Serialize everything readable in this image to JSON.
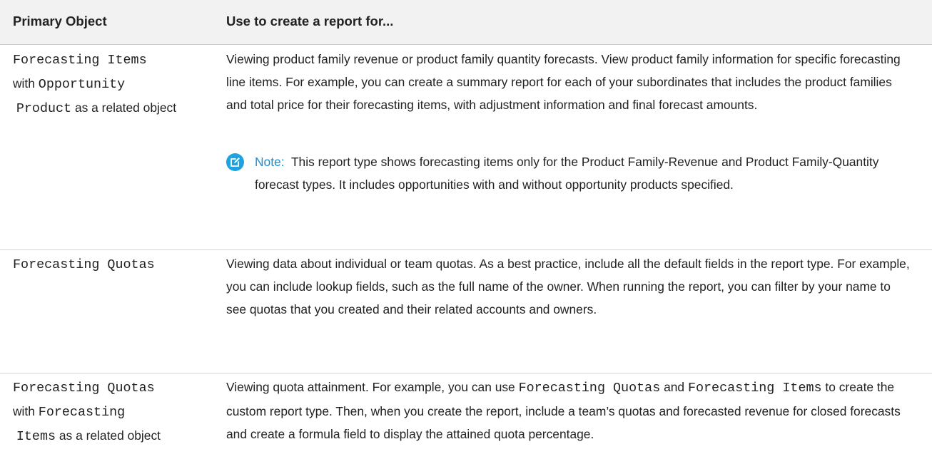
{
  "table": {
    "headers": [
      "Primary Object",
      "Use to create a report for..."
    ],
    "rows": [
      {
        "object_parts": [
          {
            "text": "Forecasting Items",
            "mono": true
          },
          {
            "text": "with",
            "mono": false
          },
          {
            "text": "Opportunity",
            "mono": true
          },
          {
            "text": "Product",
            "mono": true
          },
          {
            "text": "as a related object",
            "mono": false
          }
        ],
        "description": "Viewing product family revenue or product family quantity forecasts. View product family information for specific forecasting line items. For example, you can create a summary report for each of your subordinates that includes the product families and total price for their forecasting items, with adjustment information and final forecast amounts.",
        "note_label": "Note:",
        "note_text": "This report type shows forecasting items only for the Product Family-Revenue and Product Family-Quantity forecast types. It includes opportunities with and without opportunity products specified."
      },
      {
        "object_parts": [
          {
            "text": "Forecasting Quotas",
            "mono": true
          }
        ],
        "description": "Viewing data about individual or team quotas. As a best practice, include all the default fields in the report type. For example, you can include lookup fields, such as the full name of the owner. When running the report, you can filter by your name to see quotas that you created and their related accounts and owners."
      },
      {
        "object_parts": [
          {
            "text": "Forecasting Quotas",
            "mono": true
          },
          {
            "text": "with",
            "mono": false
          },
          {
            "text": "Forecasting",
            "mono": true
          },
          {
            "text": "Items",
            "mono": true
          },
          {
            "text": "as a related object",
            "mono": false
          }
        ],
        "description_parts": [
          {
            "text": "Viewing quota attainment. For example, you can use",
            "mono": false
          },
          {
            "text": "Forecasting Quotas",
            "mono": true
          },
          {
            "text": "and",
            "mono": false
          },
          {
            "text": "Forecasting Items",
            "mono": true
          },
          {
            "text": "to create the custom report type. Then, when you create the report, include a team’s quotas and forecasted revenue for closed forecasts and create a formula field to display the attained quota percentage.",
            "mono": false
          }
        ]
      }
    ]
  },
  "icons": {
    "note": "edit-note-icon"
  },
  "colors": {
    "note_accent": "#1a8ccf",
    "header_bg": "#f2f2f2"
  }
}
